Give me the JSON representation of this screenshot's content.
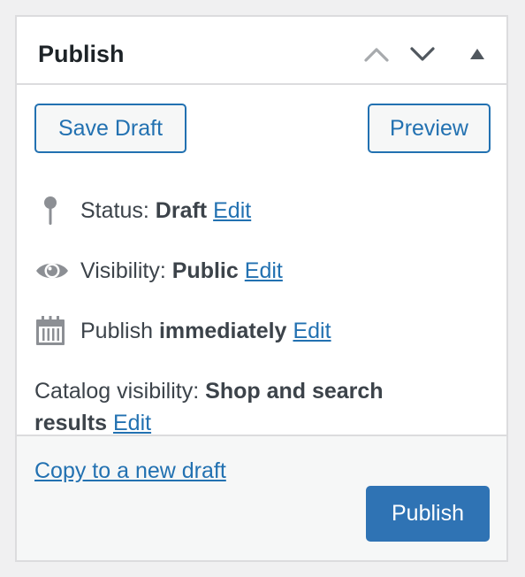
{
  "postbox": {
    "title": "Publish",
    "icons": {
      "move_up": "chevron-up-icon",
      "move_down": "chevron-down-icon",
      "toggle": "triangle-up-icon"
    }
  },
  "actions": {
    "save_draft": "Save Draft",
    "preview": "Preview"
  },
  "misc": {
    "status": {
      "label": "Status:",
      "value": "Draft",
      "edit": "Edit",
      "icon": "pin-icon"
    },
    "visibility": {
      "label": "Visibility:",
      "value": "Public",
      "edit": "Edit",
      "icon": "eye-icon"
    },
    "publish": {
      "label": "Publish",
      "value": "immediately",
      "edit": "Edit",
      "icon": "calendar-icon"
    },
    "catalog": {
      "label": "Catalog visibility:",
      "value": "Shop and search results",
      "edit": "Edit"
    }
  },
  "major": {
    "copy_link": "Copy to a new draft",
    "publish_button": "Publish"
  },
  "colors": {
    "accent": "#2271b1",
    "primary_button": "#2f73b4",
    "border": "#dcdcde",
    "icon_gray": "#8c8f94"
  }
}
